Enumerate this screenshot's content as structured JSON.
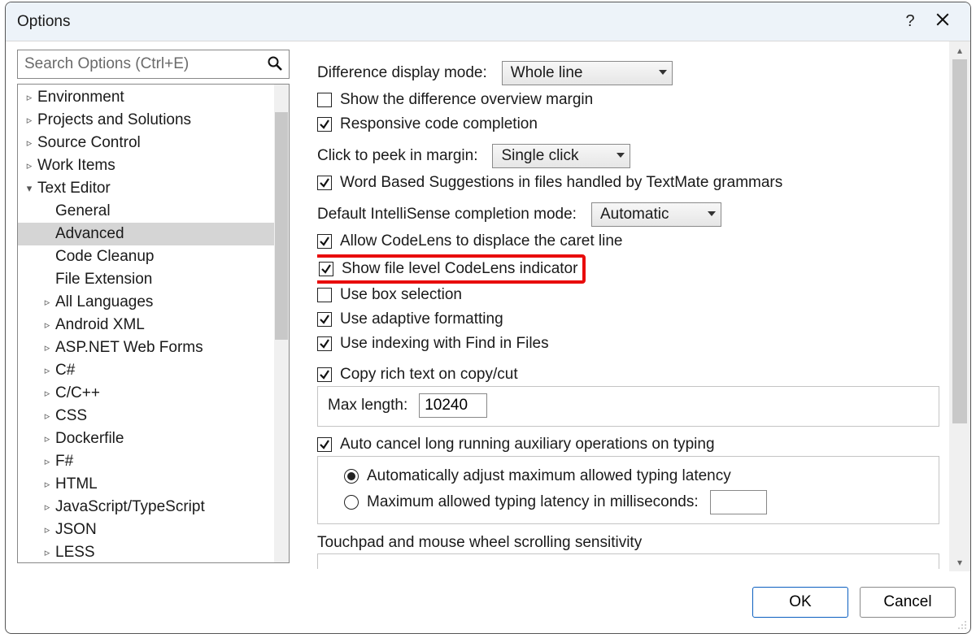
{
  "window": {
    "title": "Options",
    "help": "?",
    "close": "×"
  },
  "search": {
    "placeholder": "Search Options (Ctrl+E)"
  },
  "tree": [
    {
      "label": "Environment",
      "expandable": true,
      "expanded": false,
      "indent": 1
    },
    {
      "label": "Projects and Solutions",
      "expandable": true,
      "expanded": false,
      "indent": 1
    },
    {
      "label": "Source Control",
      "expandable": true,
      "expanded": false,
      "indent": 1
    },
    {
      "label": "Work Items",
      "expandable": true,
      "expanded": false,
      "indent": 1
    },
    {
      "label": "Text Editor",
      "expandable": true,
      "expanded": true,
      "indent": 1
    },
    {
      "label": "General",
      "expandable": false,
      "indent": 2
    },
    {
      "label": "Advanced",
      "expandable": false,
      "indent": 2,
      "selected": true
    },
    {
      "label": "Code Cleanup",
      "expandable": false,
      "indent": 2
    },
    {
      "label": "File Extension",
      "expandable": false,
      "indent": 2
    },
    {
      "label": "All Languages",
      "expandable": true,
      "expanded": false,
      "indent": 2
    },
    {
      "label": "Android XML",
      "expandable": true,
      "expanded": false,
      "indent": 2
    },
    {
      "label": "ASP.NET Web Forms",
      "expandable": true,
      "expanded": false,
      "indent": 2
    },
    {
      "label": "C#",
      "expandable": true,
      "expanded": false,
      "indent": 2
    },
    {
      "label": "C/C++",
      "expandable": true,
      "expanded": false,
      "indent": 2
    },
    {
      "label": "CSS",
      "expandable": true,
      "expanded": false,
      "indent": 2
    },
    {
      "label": "Dockerfile",
      "expandable": true,
      "expanded": false,
      "indent": 2
    },
    {
      "label": "F#",
      "expandable": true,
      "expanded": false,
      "indent": 2
    },
    {
      "label": "HTML",
      "expandable": true,
      "expanded": false,
      "indent": 2
    },
    {
      "label": "JavaScript/TypeScript",
      "expandable": true,
      "expanded": false,
      "indent": 2
    },
    {
      "label": "JSON",
      "expandable": true,
      "expanded": false,
      "indent": 2
    },
    {
      "label": "LESS",
      "expandable": true,
      "expanded": false,
      "indent": 2
    }
  ],
  "settings": {
    "diff_label": "Difference display mode:",
    "diff_value": "Whole line",
    "show_diff_overview_margin": {
      "label": "Show the difference overview margin",
      "checked": false
    },
    "responsive_code_completion": {
      "label": "Responsive code completion",
      "checked": true
    },
    "click_to_peek_label": "Click to peek in margin:",
    "click_to_peek_value": "Single click",
    "word_based_suggestions": {
      "label": "Word Based Suggestions in files handled by TextMate grammars",
      "checked": true
    },
    "intellisense_label": "Default IntelliSense completion mode:",
    "intellisense_value": "Automatic",
    "allow_codelens_displace": {
      "label": "Allow CodeLens to displace the caret line",
      "checked": true
    },
    "show_file_level_codelens": {
      "label": "Show file level CodeLens indicator",
      "checked": true,
      "highlight": true
    },
    "use_box_selection": {
      "label": "Use box selection",
      "checked": false
    },
    "use_adaptive_formatting": {
      "label": "Use adaptive formatting",
      "checked": true
    },
    "use_indexing_fif": {
      "label": "Use indexing with Find in Files",
      "checked": true
    },
    "copy_rich_text": {
      "label": "Copy rich text on copy/cut",
      "checked": true
    },
    "max_length_label": "Max length:",
    "max_length_value": "10240",
    "auto_cancel": {
      "label": "Auto cancel long running auxiliary operations on typing",
      "checked": true
    },
    "radio_auto": "Automatically adjust maximum allowed typing latency",
    "radio_max": "Maximum allowed typing latency in milliseconds:",
    "radio_selected": "auto",
    "radio_max_value": "",
    "touchpad_label": "Touchpad and mouse wheel scrolling sensitivity"
  },
  "footer": {
    "ok": "OK",
    "cancel": "Cancel"
  }
}
